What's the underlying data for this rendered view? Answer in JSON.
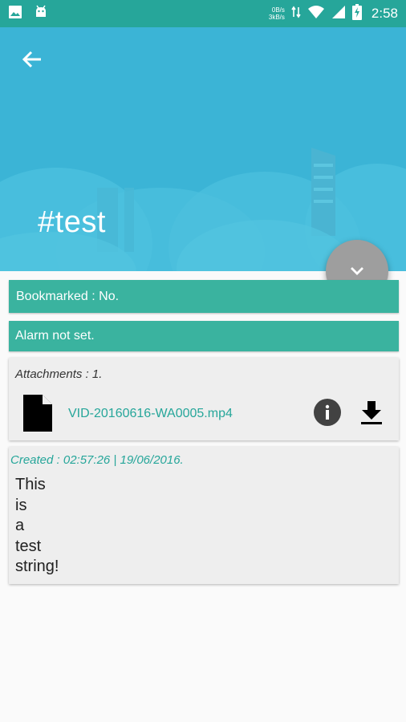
{
  "status_bar": {
    "net_speed_up": "0B/s",
    "net_speed_down": "3kB/s",
    "time": "2:58",
    "icons": [
      "image-icon",
      "android-icon",
      "data-transfer-icon",
      "wifi-icon",
      "signal-icon",
      "battery-charging-icon"
    ]
  },
  "header": {
    "title": "#test",
    "back_icon": "arrow-back-icon",
    "background_color": "#3bb4d6"
  },
  "fab": {
    "icon": "chevron-down-icon",
    "color": "#9e9e9e"
  },
  "bookmark": {
    "text": "Bookmarked : No."
  },
  "alarm": {
    "text": "Alarm not set."
  },
  "attachments": {
    "label": "Attachments : 1.",
    "items": [
      {
        "name": "VID-20160616-WA0005.mp4",
        "icon": "file-icon"
      }
    ]
  },
  "note": {
    "created": "Created :  02:57:26 | 19/06/2016.",
    "body": "This\nis\na\ntest\nstring!"
  },
  "colors": {
    "accent": "#3ab39f",
    "status_bar": "#26a69a"
  }
}
